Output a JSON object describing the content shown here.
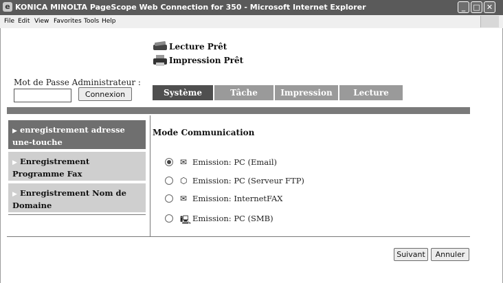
{
  "window": {
    "title": "KONICA MINOLTA PageScope Web Connection for 350 - Microsoft Internet Explorer",
    "controls": [
      "minimize",
      "maximize",
      "close"
    ]
  },
  "menubar": {
    "items": [
      "File",
      "Edit",
      "View",
      "Favorites",
      "Tools",
      "Help"
    ]
  },
  "status": {
    "scan": {
      "icon": "scanner-icon",
      "text": "Lecture Prêt"
    },
    "print": {
      "icon": "printer-icon",
      "text": "Impression Prêt"
    }
  },
  "login": {
    "label": "Mot de Passe Administrateur :",
    "password_value": "",
    "button": "Connexion"
  },
  "tabs": [
    {
      "label": "Système",
      "active": true
    },
    {
      "label": "Tâche",
      "active": false
    },
    {
      "label": "Impression",
      "active": false
    },
    {
      "label": "Lecture",
      "active": false
    }
  ],
  "sidebar": {
    "items": [
      {
        "label": "enregistrement adresse une-touche",
        "active": true
      },
      {
        "label": "Enregistrement Programme Fax",
        "active": false
      },
      {
        "label": "Enregistrement Nom de Domaine",
        "active": false
      }
    ]
  },
  "main": {
    "title": "Mode Communication",
    "options": [
      {
        "label": "Emission: PC (Email)",
        "icon": "envelope-icon",
        "selected": true
      },
      {
        "label": "Emission: PC (Serveur FTP)",
        "icon": "ftp-server-icon",
        "selected": false
      },
      {
        "label": "Emission: InternetFAX",
        "icon": "envelope-icon",
        "selected": false
      },
      {
        "label": "Emission: PC (SMB)",
        "icon": "network-pc-icon",
        "selected": false
      }
    ]
  },
  "footer": {
    "next": "Suivant",
    "cancel": "Annuler"
  },
  "colors": {
    "tab_active": "#4f4f4f",
    "tab_inactive": "#9a9a9a",
    "side_active": "#6f6f6f",
    "side_inactive": "#cfcfcf"
  }
}
